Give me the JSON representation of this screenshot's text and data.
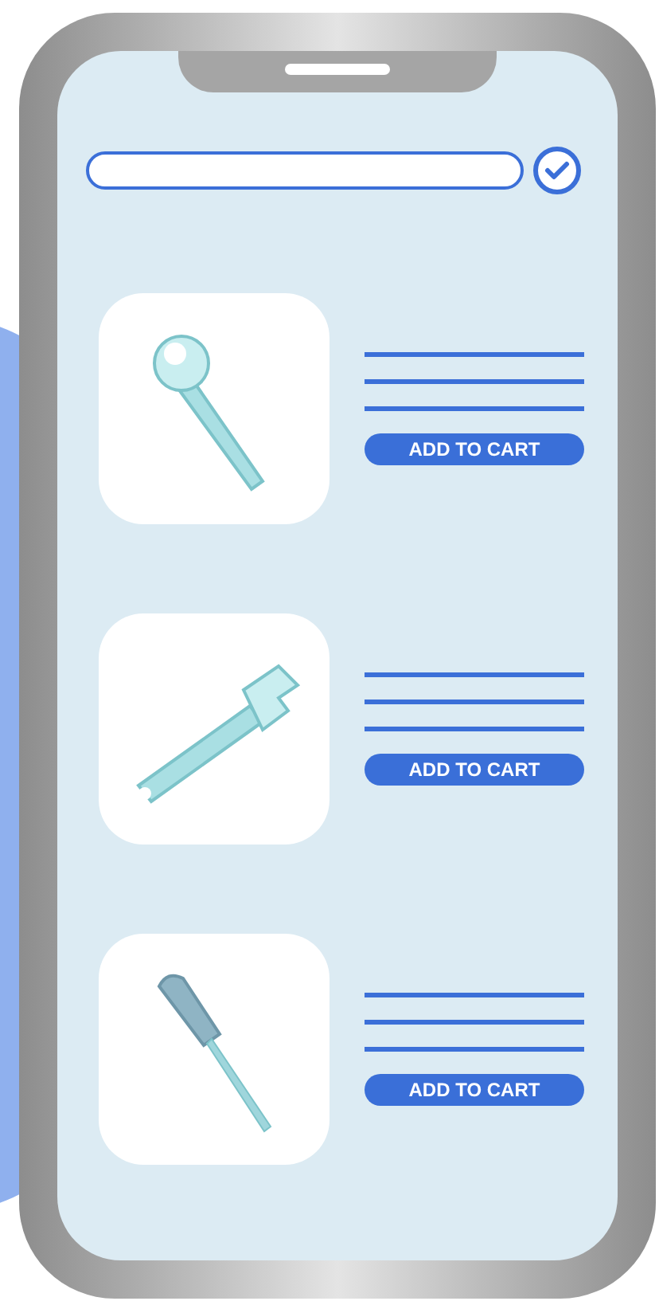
{
  "search": {
    "confirmed": true
  },
  "products": [
    {
      "kind": "wrench",
      "button": "ADD TO CART"
    },
    {
      "kind": "adjustable-wrench",
      "button": "ADD TO CART"
    },
    {
      "kind": "screwdriver",
      "button": "ADD TO CART"
    }
  ]
}
